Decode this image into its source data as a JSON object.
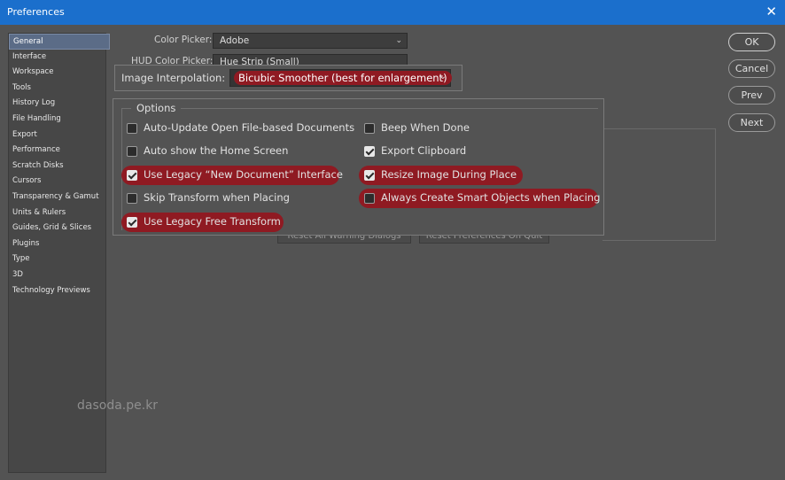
{
  "window": {
    "title": "Preferences",
    "close_glyph": "✕"
  },
  "sidebar": {
    "items": [
      {
        "label": "General",
        "selected": true
      },
      {
        "label": "Interface"
      },
      {
        "label": "Workspace"
      },
      {
        "label": "Tools"
      },
      {
        "label": "History Log"
      },
      {
        "label": "File Handling"
      },
      {
        "label": "Export"
      },
      {
        "label": "Performance"
      },
      {
        "label": "Scratch Disks"
      },
      {
        "label": "Cursors"
      },
      {
        "label": "Transparency & Gamut"
      },
      {
        "label": "Units & Rulers"
      },
      {
        "label": "Guides, Grid & Slices"
      },
      {
        "label": "Plugins"
      },
      {
        "label": "Type"
      },
      {
        "label": "3D"
      },
      {
        "label": "Technology Previews"
      }
    ]
  },
  "general": {
    "color_picker_label": "Color Picker:",
    "color_picker_value": "Adobe",
    "hud_color_picker_label": "HUD Color Picker:",
    "hud_color_picker_value": "Hue Strip (Small)",
    "image_interpolation_label": "Image Interpolation:",
    "image_interpolation_value": "Bicubic Smoother (best for enlargement)",
    "reset_warning_label": "Reset All Warning Dialogs",
    "reset_prefs_label": "Reset Preferences On Quit",
    "chevron": "⌄"
  },
  "options": {
    "title": "Options",
    "items": [
      {
        "label": "Auto-Update Open File-based Documents",
        "checked": false,
        "highlighted": false
      },
      {
        "label": "Beep When Done",
        "checked": false,
        "highlighted": false
      },
      {
        "label": "Auto show the Home Screen",
        "checked": false,
        "highlighted": false
      },
      {
        "label": "Export Clipboard",
        "checked": true,
        "highlighted": false
      },
      {
        "label": "Use Legacy “New Document” Interface",
        "checked": true,
        "highlighted": true
      },
      {
        "label": "Resize Image During Place",
        "checked": true,
        "highlighted": true
      },
      {
        "label": "Skip Transform when Placing",
        "checked": false,
        "highlighted": false
      },
      {
        "label": "Always Create Smart Objects when Placing",
        "checked": false,
        "highlighted": true
      },
      {
        "label": "Use Legacy Free Transform",
        "checked": true,
        "highlighted": true
      }
    ]
  },
  "buttons": {
    "ok": "OK",
    "cancel": "Cancel",
    "prev": "Prev",
    "next": "Next"
  },
  "watermark": "dasoda.pe.kr",
  "colors": {
    "titlebar": "#1b6fcc",
    "highlight": "#8f1a22",
    "background": "#535353"
  }
}
